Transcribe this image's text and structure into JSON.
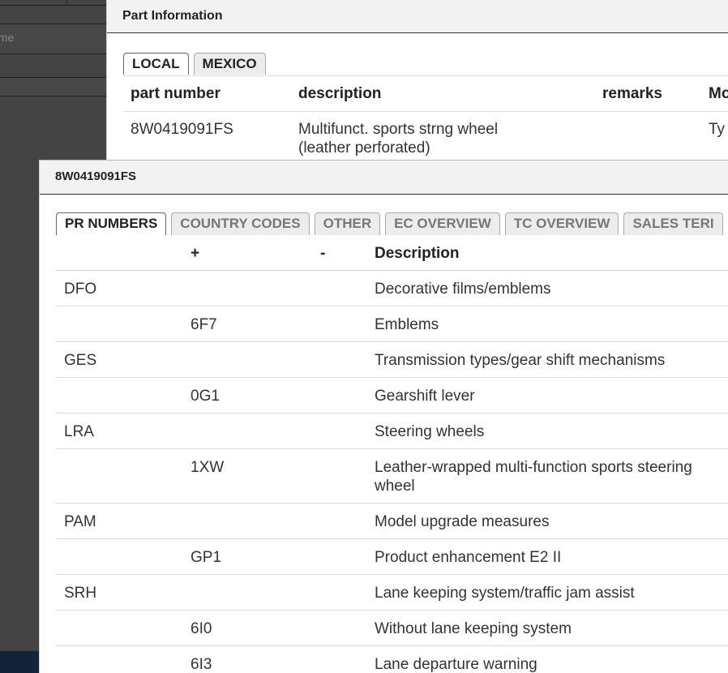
{
  "background": {
    "name_field_placeholder": "ame"
  },
  "part_dialog": {
    "title": "Part Information",
    "tabs": [
      {
        "label": "LOCAL",
        "active": true
      },
      {
        "label": "MEXICO",
        "active": false
      }
    ],
    "columns": {
      "part_number": "part number",
      "description": "description",
      "remarks": "remarks",
      "model": "Mo"
    },
    "row": {
      "part_number": "8W0419091FS",
      "description_line1": "Multifunct. sports strng wheel",
      "description_line2": "(leather perforated)",
      "remarks": "",
      "model": "Ty"
    }
  },
  "pr_dialog": {
    "title": "8W0419091FS",
    "tabs": [
      {
        "label": "PR NUMBERS",
        "active": true
      },
      {
        "label": "COUNTRY CODES",
        "active": false
      },
      {
        "label": "OTHER",
        "active": false
      },
      {
        "label": "EC OVERVIEW",
        "active": false
      },
      {
        "label": "TC OVERVIEW",
        "active": false
      },
      {
        "label": "SALES TERI",
        "active": false
      }
    ],
    "columns": {
      "code": "",
      "plus": "+",
      "minus": "-",
      "description": "Description"
    },
    "rows": [
      {
        "code": "DFO",
        "plus": "",
        "minus": "",
        "description": "Decorative films/emblems"
      },
      {
        "code": "",
        "plus": "6F7",
        "minus": "",
        "description": "Emblems"
      },
      {
        "code": "GES",
        "plus": "",
        "minus": "",
        "description": "Transmission types/gear shift mechanisms"
      },
      {
        "code": "",
        "plus": "0G1",
        "minus": "",
        "description": "Gearshift lever"
      },
      {
        "code": "LRA",
        "plus": "",
        "minus": "",
        "description": "Steering wheels"
      },
      {
        "code": "",
        "plus": "1XW",
        "minus": "",
        "description": "Leather-wrapped multi-function sports steering wheel"
      },
      {
        "code": "PAM",
        "plus": "",
        "minus": "",
        "description": "Model upgrade measures"
      },
      {
        "code": "",
        "plus": "GP1",
        "minus": "",
        "description": "Product enhancement E2 II"
      },
      {
        "code": "SRH",
        "plus": "",
        "minus": "",
        "description": "Lane keeping system/traffic jam assist"
      },
      {
        "code": "",
        "plus": "6I0",
        "minus": "",
        "description": "Without lane keeping system"
      },
      {
        "code": "",
        "plus": "6I3",
        "minus": "",
        "description": "Lane departure warning"
      }
    ]
  }
}
